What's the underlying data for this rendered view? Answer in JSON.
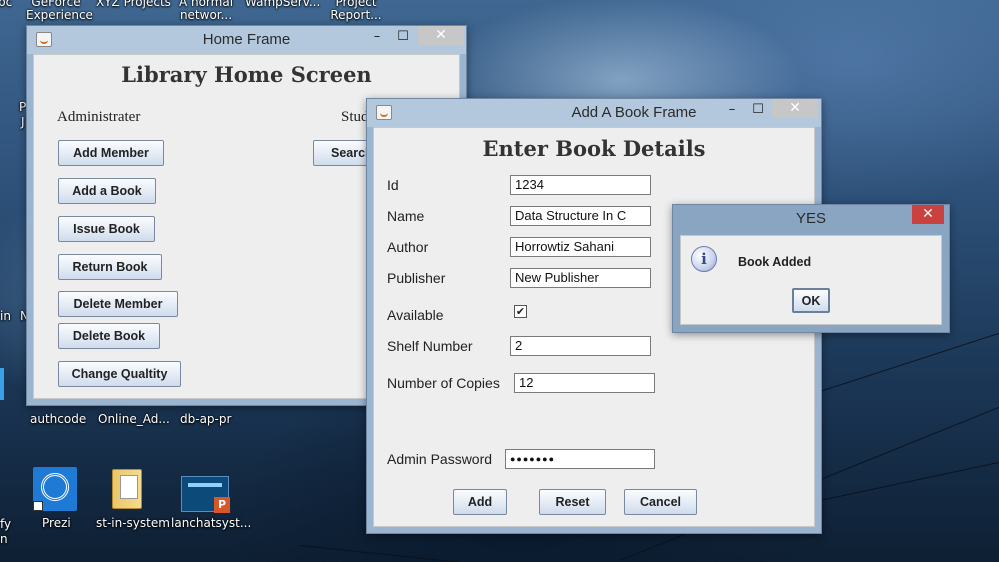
{
  "desktop": {
    "top_icons": [
      "bc",
      "GeForce Experience",
      "XYZ Projects",
      "A normal networ...",
      "WampServ...",
      "Project Report..."
    ],
    "mid_icons": [
      "authcode",
      "Online_Ad...",
      "db-ap-pr"
    ],
    "bottom_icons": [
      "Prezi",
      "st-in-system",
      "lanchatsyst..."
    ],
    "edge_labels": [
      "P",
      "J",
      "in",
      "N",
      "fy",
      "n"
    ]
  },
  "home_frame": {
    "title": "Home Frame",
    "heading": "Library Home Screen",
    "admin_label": "Administrater",
    "student_label": "Stud",
    "buttons": [
      "Add Member",
      "Add a Book",
      "Issue Book",
      "Return Book",
      "Delete Member",
      "Delete Book",
      "Change Qualtity"
    ],
    "search_button": "Searcl",
    "controls": {
      "minimize": "–",
      "maximize": "☐",
      "close": "✕"
    }
  },
  "add_book_frame": {
    "title": "Add A Book Frame",
    "heading": "Enter Book Details",
    "fields": {
      "id": {
        "label": "Id",
        "value": "1234"
      },
      "name": {
        "label": "Name",
        "value": "Data Structure In C"
      },
      "author": {
        "label": "Author",
        "value": "Horrowtiz Sahani"
      },
      "publisher": {
        "label": "Publisher",
        "value": "New Publisher"
      },
      "available": {
        "label": "Available",
        "checked": true,
        "mark": "✔"
      },
      "shelf": {
        "label": "Shelf Number",
        "value": "2"
      },
      "copies": {
        "label": "Number of Copies",
        "value": "12"
      },
      "password": {
        "label": "Admin Password",
        "value": "●●●●●●●"
      }
    },
    "buttons": {
      "add": "Add",
      "reset": "Reset",
      "cancel": "Cancel"
    },
    "controls": {
      "minimize": "–",
      "maximize": "☐",
      "close": "✕"
    }
  },
  "dialog": {
    "title": "YES",
    "message": "Book Added",
    "ok": "OK",
    "info_glyph": "i",
    "close": "✕"
  }
}
